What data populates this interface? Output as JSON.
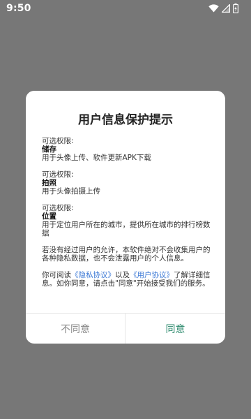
{
  "status_bar": {
    "time": "9:50",
    "icons": [
      "wifi-icon",
      "signal-icon",
      "battery-icon"
    ]
  },
  "dialog": {
    "title": "用户信息保护提示",
    "permissions": [
      {
        "label": "可选权限:",
        "name": "储存",
        "desc": "用于头像上传、软件更新APK下载"
      },
      {
        "label": "可选权限:",
        "name": "拍照",
        "desc": "用于头像拍摄上传"
      },
      {
        "label": "可选权限:",
        "name": "位置",
        "desc": "用于定位用户所在的城市，提供所在城市的排行榜数据"
      }
    ],
    "privacy_statement": "若没有经过用户的允许，本软件绝对不会收集用户的各种隐私数据，也不会泄露用户的个人信息。",
    "agreement": {
      "prefix": "你可阅读",
      "privacy_link": "《隐私协议》",
      "and": "以及",
      "user_link": "《用户协议》",
      "suffix": "了解详细信息。如你同意，请点击\"同意\"开始接受我们的服务。"
    },
    "buttons": {
      "disagree": "不同意",
      "agree": "同意"
    }
  },
  "colors": {
    "overlay": "#777777",
    "link": "#3f7bd6",
    "agree": "#2d8a6d",
    "disagree": "#888888"
  }
}
